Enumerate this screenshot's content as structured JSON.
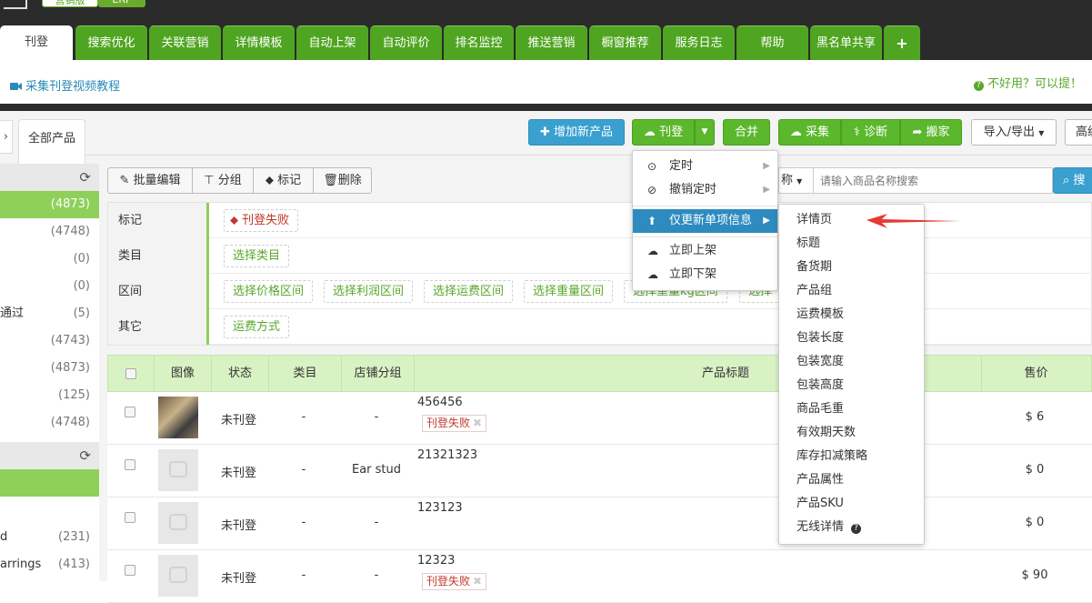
{
  "brand": {
    "badge1": "营销版",
    "badge2": "ERP"
  },
  "tabs": [
    {
      "label": "刊登",
      "active": true
    },
    {
      "label": "搜索优化"
    },
    {
      "label": "关联营销"
    },
    {
      "label": "详情模板"
    },
    {
      "label": "自动上架"
    },
    {
      "label": "自动评价"
    },
    {
      "label": "排名监控"
    },
    {
      "label": "推送营销"
    },
    {
      "label": "橱窗推荐"
    },
    {
      "label": "服务日志"
    },
    {
      "label": "帮助"
    },
    {
      "label": "黑名单共享"
    },
    {
      "label": "+"
    }
  ],
  "subheader": {
    "video_link": "采集刊登视频教程",
    "feedback": "不好用？可以提！"
  },
  "crumb": {
    "arrow": "›",
    "tab": "全部产品"
  },
  "toolbar": {
    "add_product": "增加新产品",
    "publish": "刊登",
    "merge": "合并",
    "collect": "采集",
    "diagnose": "诊断",
    "move": "搬家",
    "import_export": "导入/导出",
    "advanced": "高级"
  },
  "bulk": {
    "edit": "批量编辑",
    "group": "分组",
    "mark": "标记",
    "delete": "删除"
  },
  "search": {
    "field": "称",
    "placeholder": "请输入商品名称搜索",
    "button": "搜"
  },
  "sidebar": {
    "rows1": [
      {
        "label": "",
        "count": "(4873)",
        "active": true
      },
      {
        "label": "",
        "count": "(4748)"
      },
      {
        "label": "",
        "count": "(0)"
      },
      {
        "label": "",
        "count": "(0)"
      },
      {
        "label": "通过",
        "count": "(5)"
      },
      {
        "label": "",
        "count": "(4743)"
      },
      {
        "label": "",
        "count": "(4873)"
      },
      {
        "label": "",
        "count": "(125)"
      },
      {
        "label": "",
        "count": "(4748)"
      }
    ],
    "rows2": [
      {
        "label": "d",
        "count": "(231)"
      },
      {
        "label": "arrings",
        "count": "(413)"
      }
    ]
  },
  "filters": [
    {
      "label": "标记",
      "chips": [
        "刊登失败"
      ]
    },
    {
      "label": "类目",
      "chips": [
        "选择类目"
      ]
    },
    {
      "label": "区间",
      "chips": [
        "选择价格区间",
        "选择利润区间",
        "选择运费区间",
        "选择重量区间",
        "选择重量kg区间",
        "选择"
      ]
    },
    {
      "label": "其它",
      "chips": [
        "运费方式"
      ]
    }
  ],
  "table": {
    "headers": {
      "image": "图像",
      "status": "状态",
      "category": "类目",
      "shop_group": "店铺分组",
      "title": "产品标题",
      "price": "售价"
    },
    "rows": [
      {
        "status": "未刊登",
        "category": "-",
        "group": "-",
        "title": "456456",
        "tag": "刊登失败",
        "price": "$ 6",
        "photo": true
      },
      {
        "status": "未刊登",
        "category": "-",
        "group": "Ear stud",
        "title": "21321323",
        "tag": "",
        "price": "$ 0",
        "photo": false
      },
      {
        "status": "未刊登",
        "category": "-",
        "group": "-",
        "title": "123123",
        "tag": "",
        "price": "$ 0",
        "photo": false
      },
      {
        "status": "未刊登",
        "category": "-",
        "group": "-",
        "title": "12323",
        "tag": "刊登失败",
        "price": "$ 90",
        "photo": false
      }
    ]
  },
  "publish_menu": {
    "items": [
      {
        "label": "定时",
        "icon": "clock-icon",
        "glyph": "⊙",
        "submenu": true
      },
      {
        "label": "撤销定时",
        "icon": "ban-icon",
        "glyph": "⊘",
        "submenu": true
      },
      {
        "label": "仅更新单项信息",
        "icon": "upload-circle-icon",
        "glyph": "⬆",
        "submenu": true,
        "active": true
      },
      {
        "label": "立即上架",
        "icon": "cloud-upload-icon",
        "glyph": "☁",
        "submenu": false
      },
      {
        "label": "立即下架",
        "icon": "cloud-download-icon",
        "glyph": "☁",
        "submenu": false
      }
    ]
  },
  "update_submenu": {
    "items": [
      "详情页",
      "标题",
      "备货期",
      "产品组",
      "运费模板",
      "包装长度",
      "包装宽度",
      "包装高度",
      "商品毛重",
      "有效期天数",
      "库存扣减策略",
      "产品属性",
      "产品SKU",
      "无线详情"
    ]
  },
  "colors": {
    "green": "#5bb72b",
    "blue": "#3aa0cf",
    "dark": "#2b2b2b",
    "arrow": "#e53935"
  }
}
